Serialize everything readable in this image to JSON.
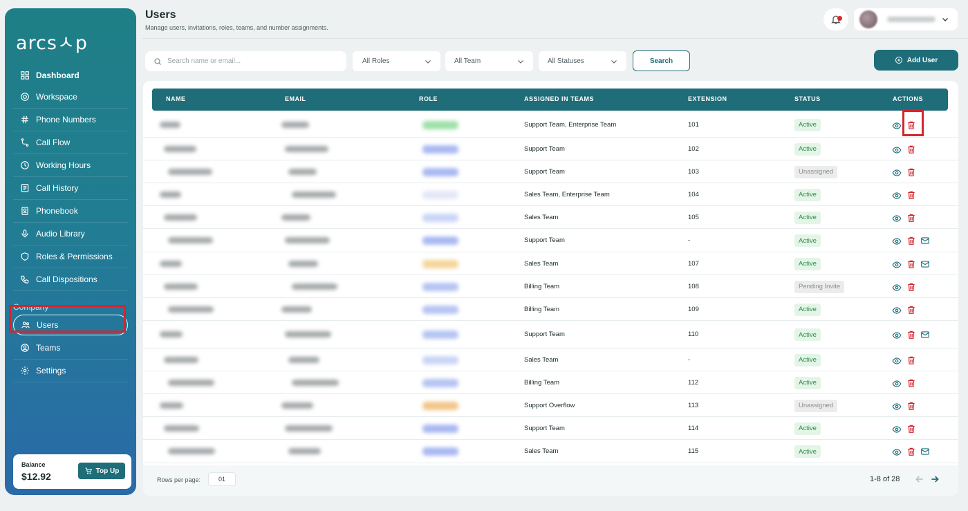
{
  "brand": {
    "logo_text": "arcsㅅp"
  },
  "sidebar": {
    "items": [
      {
        "label": "Dashboard",
        "icon": "grid-icon"
      },
      {
        "label": "Workspace",
        "icon": "workspace-icon"
      },
      {
        "label": "Phone Numbers",
        "icon": "hash-icon"
      },
      {
        "label": "Call Flow",
        "icon": "flow-icon"
      },
      {
        "label": "Working Hours",
        "icon": "clock-icon"
      },
      {
        "label": "Call History",
        "icon": "history-icon"
      },
      {
        "label": "Phonebook",
        "icon": "phonebook-icon"
      },
      {
        "label": "Audio Library",
        "icon": "mic-icon"
      },
      {
        "label": "Roles & Permissions",
        "icon": "shield-icon"
      },
      {
        "label": "Call Dispositions",
        "icon": "phone-icon"
      }
    ],
    "section_label": "Company",
    "company_items": [
      {
        "label": "Users",
        "icon": "users-icon"
      },
      {
        "label": "Teams",
        "icon": "teams-icon"
      },
      {
        "label": "Settings",
        "icon": "gear-icon"
      }
    ],
    "balance_label": "Balance",
    "balance_value": "$12.92",
    "topup_label": "Top Up"
  },
  "header": {
    "title": "Users",
    "subtitle": "Manage users, invitations, roles, teams, and number assignments."
  },
  "filters": {
    "search_placeholder": "Search name or email...",
    "roles": "All Roles",
    "team": "All Team",
    "statuses": "All Statuses",
    "search_button": "Search",
    "add_user_button": "Add User"
  },
  "table": {
    "columns": [
      "NAME",
      "EMAIL",
      "ROLE",
      "ASSIGNED IN TEAMS",
      "EXTENSION",
      "STATUS",
      "ACTIONS"
    ],
    "rows": [
      {
        "teams": "Support Team, Enterprise Team",
        "extension": "101",
        "status": "Active",
        "role_color": "#9ee0a8",
        "mail": false
      },
      {
        "teams": "Support Team",
        "extension": "102",
        "status": "Active",
        "role_color": "#a9b9f2",
        "mail": false
      },
      {
        "teams": "Support Team",
        "extension": "103",
        "status": "Unassigned",
        "role_color": "#a9b9f2",
        "mail": false
      },
      {
        "teams": "Sales Team, Enterprise Team",
        "extension": "104",
        "status": "Active",
        "role_color": "#e4e8f6",
        "mail": false
      },
      {
        "teams": "Sales Team",
        "extension": "105",
        "status": "Active",
        "role_color": "#c9d5f6",
        "mail": false
      },
      {
        "teams": "Support Team",
        "extension": "-",
        "status": "Active",
        "role_color": "#a9b9f2",
        "mail": true
      },
      {
        "teams": "Sales Team",
        "extension": "107",
        "status": "Active",
        "role_color": "#f5d59a",
        "mail": true
      },
      {
        "teams": "Billing Team",
        "extension": "108",
        "status": "Pending Invite",
        "role_color": "#b5c4f2",
        "mail": false
      },
      {
        "teams": "Billing Team",
        "extension": "109",
        "status": "Active",
        "role_color": "#b5c4f2",
        "mail": false
      },
      {
        "teams": "Support Team",
        "extension": "110",
        "status": "Active",
        "role_color": "#b5c4f2",
        "mail": true
      },
      {
        "teams": "Sales Team",
        "extension": "-",
        "status": "Active",
        "role_color": "#c9d5f6",
        "mail": false
      },
      {
        "teams": "Billing Team",
        "extension": "112",
        "status": "Active",
        "role_color": "#b5c4f2",
        "mail": false
      },
      {
        "teams": "Support Overflow",
        "extension": "113",
        "status": "Unassigned",
        "role_color": "#f2c58a",
        "mail": false
      },
      {
        "teams": "Support Team",
        "extension": "114",
        "status": "Active",
        "role_color": "#a9b9f2",
        "mail": false
      },
      {
        "teams": "Sales Team",
        "extension": "115",
        "status": "Active",
        "role_color": "#a9b9f2",
        "mail": true
      }
    ]
  },
  "pagination": {
    "rows_per_page_label": "Rows per page:",
    "rows_per_page_value": "01",
    "range": "1-8 of 28"
  },
  "colors": {
    "primary": "#1e6d79",
    "danger": "#d3262d",
    "active_bg": "#e3f5e7"
  }
}
